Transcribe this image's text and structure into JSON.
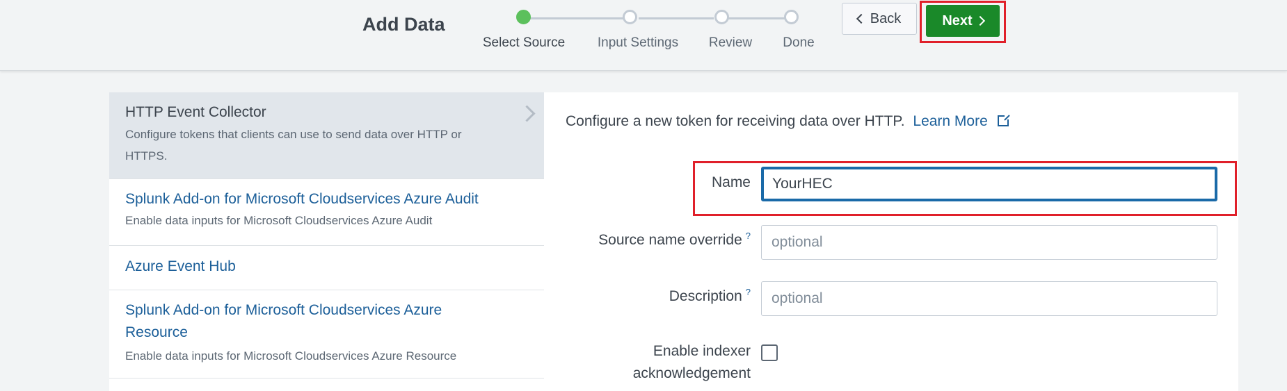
{
  "header": {
    "title": "Add Data",
    "steps": [
      {
        "label": "Select Source",
        "active": true
      },
      {
        "label": "Input Settings",
        "active": false
      },
      {
        "label": "Review",
        "active": false
      },
      {
        "label": "Done",
        "active": false
      }
    ],
    "back_label": "Back",
    "next_label": "Next"
  },
  "colors": {
    "next_button": "#1a8929",
    "active_step": "#5cc05c",
    "link": "#1c5f99",
    "highlight": "#e0202a"
  },
  "sources": [
    {
      "title": "HTTP Event Collector",
      "desc": "Configure tokens that clients can use to send data over HTTP or",
      "desc2": "HTTPS.",
      "selected": true
    },
    {
      "title": "Splunk Add-on for Microsoft Cloudservices Azure Audit",
      "desc": "Enable data inputs for Microsoft Cloudservices Azure Audit"
    },
    {
      "title": "Azure Event Hub"
    },
    {
      "title": "Splunk Add-on for Microsoft Cloudservices Azure",
      "title2": "Resource",
      "desc": "Enable data inputs for Microsoft Cloudservices Azure Resource"
    }
  ],
  "form": {
    "intro": "Configure a new token for receiving data over HTTP.",
    "learn_more": "Learn More",
    "name_label": "Name",
    "name_value": "YourHEC",
    "source_label": "Source name override",
    "source_placeholder": "optional",
    "desc_label": "Description",
    "desc_placeholder": "optional",
    "help_mark": "?",
    "ack_label_line1": "Enable indexer",
    "ack_label_line2": "acknowledgement",
    "ack_checked": false
  }
}
